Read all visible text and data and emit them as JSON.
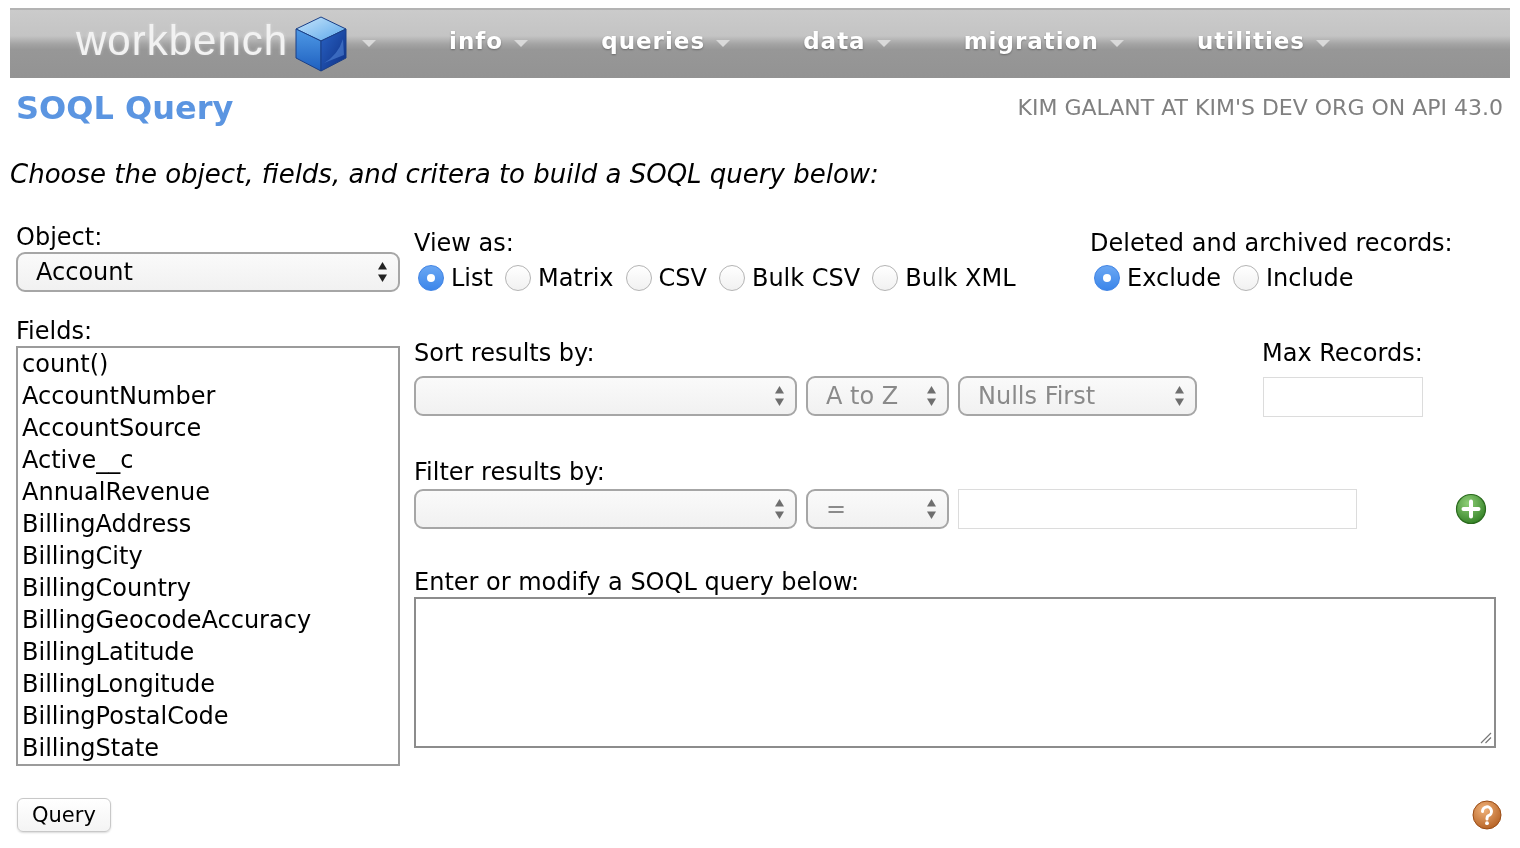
{
  "navbar": {
    "logo": "workbench",
    "menus": [
      "info",
      "queries",
      "data",
      "migration",
      "utilities"
    ]
  },
  "header": {
    "title": "SOQL Query",
    "user_info": "KIM GALANT AT KIM'S DEV ORG ON API 43.0"
  },
  "instructions": "Choose the object, fields, and critera to build a SOQL query below:",
  "object": {
    "label": "Object:",
    "value": "Account"
  },
  "fields": {
    "label": "Fields:",
    "items": [
      {
        "label": "count()",
        "selected": false
      },
      {
        "label": "AccountNumber",
        "selected": false
      },
      {
        "label": "AccountSource",
        "selected": false
      },
      {
        "label": "Active__c",
        "selected": false
      },
      {
        "label": "AnnualRevenue",
        "selected": false
      },
      {
        "label": "BillingAddress",
        "selected": false
      },
      {
        "label": "BillingCity",
        "selected": false
      },
      {
        "label": "BillingCountry",
        "selected": false
      },
      {
        "label": "BillingGeocodeAccuracy",
        "selected": false
      },
      {
        "label": "BillingLatitude",
        "selected": false
      },
      {
        "label": "BillingLongitude",
        "selected": false
      },
      {
        "label": "BillingPostalCode",
        "selected": false
      },
      {
        "label": "BillingState",
        "selected": false
      }
    ]
  },
  "view_as": {
    "label": "View as:",
    "options": [
      {
        "label": "List",
        "selected": true
      },
      {
        "label": "Matrix",
        "selected": false
      },
      {
        "label": "CSV",
        "selected": false
      },
      {
        "label": "Bulk CSV",
        "selected": false
      },
      {
        "label": "Bulk XML",
        "selected": false
      }
    ]
  },
  "deleted_records": {
    "label": "Deleted and archived records:",
    "options": [
      {
        "label": "Exclude",
        "selected": true
      },
      {
        "label": "Include",
        "selected": false
      }
    ]
  },
  "sort": {
    "label": "Sort results by:",
    "direction": {
      "value": "A to Z",
      "disabled": true
    },
    "nulls": {
      "value": "Nulls First",
      "disabled": true
    }
  },
  "max_records": {
    "label": "Max Records:"
  },
  "filter": {
    "label": "Filter results by:",
    "operator": {
      "value": "=",
      "disabled": true
    }
  },
  "query_editor": {
    "label": "Enter or modify a SOQL query below:"
  },
  "query_button": "Query"
}
